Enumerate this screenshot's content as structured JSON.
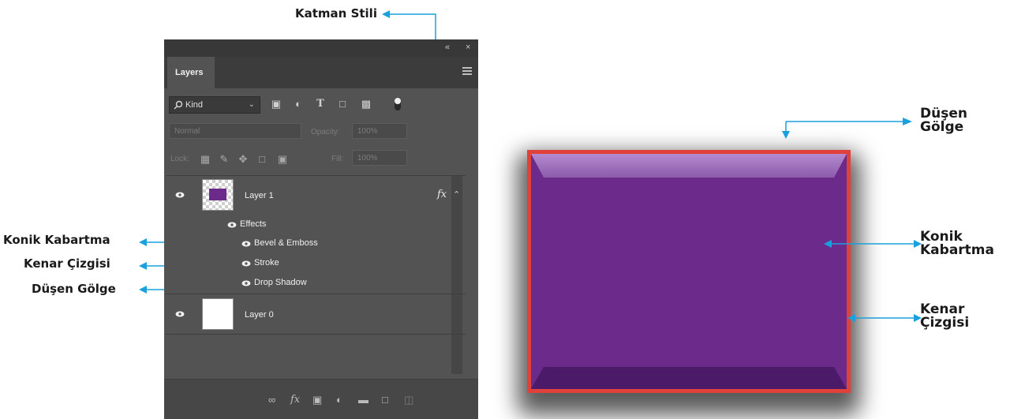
{
  "callouts": {
    "katman_stili": "Katman Stili",
    "konik_kabartma_left": "Konik Kabartma",
    "kenar_cizgisi_left": "Kenar Çizgisi",
    "dusen_golge_left": "Düşen Gölge",
    "dusen_golge_right_1": "Düşen",
    "dusen_golge_right_2": "Gölge",
    "konik_kabartma_right_1": "Konik",
    "konik_kabartma_right_2": "Kabartma",
    "kenar_cizgisi_right_1": "Kenar",
    "kenar_cizgisi_right_2": "Çizgisi"
  },
  "panel": {
    "collapse_icon": "double-chevron-left-icon",
    "close_icon": "close-icon",
    "tab_label": "Layers",
    "filter": {
      "kind_label": "Kind"
    },
    "blend_mode": "Normal",
    "opacity_label": "Opacity:",
    "opacity_value": "100%",
    "lock_label": "Lock:",
    "fill_label": "Fill:",
    "fill_value": "100%",
    "layers": [
      {
        "name": "Layer 1",
        "fx": "fx",
        "effects_label": "Effects",
        "effects": [
          "Bevel & Emboss",
          "Stroke",
          "Drop Shadow"
        ]
      },
      {
        "name": "Layer 0"
      }
    ]
  },
  "colors": {
    "arrow": "#1aa0dc",
    "panel_bg": "#535353",
    "button_fill": "#6c2a8b",
    "button_stroke": "#e0413a"
  }
}
